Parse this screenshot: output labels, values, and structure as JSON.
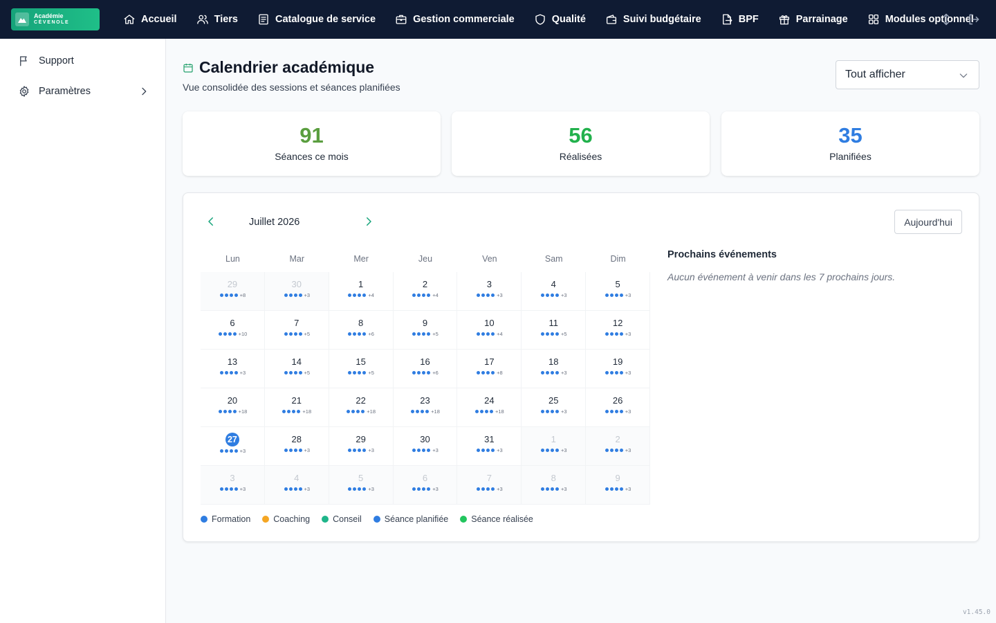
{
  "brand": {
    "line1": "Académie",
    "line2": "CÉVENOLE"
  },
  "nav": [
    {
      "label": "Accueil",
      "icon": "home-icon"
    },
    {
      "label": "Tiers",
      "icon": "users-icon"
    },
    {
      "label": "Catalogue de service",
      "icon": "catalog-icon"
    },
    {
      "label": "Gestion commerciale",
      "icon": "briefcase-icon"
    },
    {
      "label": "Qualité",
      "icon": "shield-icon"
    },
    {
      "label": "Suivi budgétaire",
      "icon": "wallet-icon"
    },
    {
      "label": "BPF",
      "icon": "bpf-icon"
    },
    {
      "label": "Parrainage",
      "icon": "gift-icon"
    },
    {
      "label": "Modules optionnel",
      "icon": "grid-icon"
    }
  ],
  "sidebar": [
    {
      "label": "Support",
      "icon": "flag-icon"
    },
    {
      "label": "Paramètres",
      "icon": "gear-icon"
    }
  ],
  "header": {
    "title": "Calendrier académique",
    "subtitle": "Vue consolidée des sessions et séances planifiées",
    "filter": "Tout afficher"
  },
  "stats": [
    {
      "value": "91",
      "label": "Séances ce mois",
      "color": "#5a9e3f"
    },
    {
      "value": "56",
      "label": "Réalisées",
      "color": "#22b14c"
    },
    {
      "value": "35",
      "label": "Planifiées",
      "color": "#2f7de1"
    }
  ],
  "calendar": {
    "month": "Juillet 2026",
    "today_button": "Aujourd'hui",
    "weekdays": [
      "Lun",
      "Mar",
      "Mer",
      "Jeu",
      "Ven",
      "Sam",
      "Dim"
    ],
    "weeks": [
      [
        {
          "d": "29",
          "m": "+8",
          "o": true
        },
        {
          "d": "30",
          "m": "+3",
          "o": true
        },
        {
          "d": "1",
          "m": "+4"
        },
        {
          "d": "2",
          "m": "+4"
        },
        {
          "d": "3",
          "m": "+3"
        },
        {
          "d": "4",
          "m": "+3"
        },
        {
          "d": "5",
          "m": "+3"
        }
      ],
      [
        {
          "d": "6",
          "m": "+10"
        },
        {
          "d": "7",
          "m": "+5"
        },
        {
          "d": "8",
          "m": "+6"
        },
        {
          "d": "9",
          "m": "+5"
        },
        {
          "d": "10",
          "m": "+4"
        },
        {
          "d": "11",
          "m": "+5"
        },
        {
          "d": "12",
          "m": "+3"
        }
      ],
      [
        {
          "d": "13",
          "m": "+3"
        },
        {
          "d": "14",
          "m": "+5"
        },
        {
          "d": "15",
          "m": "+5"
        },
        {
          "d": "16",
          "m": "+6"
        },
        {
          "d": "17",
          "m": "+8"
        },
        {
          "d": "18",
          "m": "+3"
        },
        {
          "d": "19",
          "m": "+3"
        }
      ],
      [
        {
          "d": "20",
          "m": "+18"
        },
        {
          "d": "21",
          "m": "+18"
        },
        {
          "d": "22",
          "m": "+18"
        },
        {
          "d": "23",
          "m": "+18"
        },
        {
          "d": "24",
          "m": "+18"
        },
        {
          "d": "25",
          "m": "+3"
        },
        {
          "d": "26",
          "m": "+3"
        }
      ],
      [
        {
          "d": "27",
          "m": "+3",
          "t": true
        },
        {
          "d": "28",
          "m": "+3"
        },
        {
          "d": "29",
          "m": "+3"
        },
        {
          "d": "30",
          "m": "+3"
        },
        {
          "d": "31",
          "m": "+3"
        },
        {
          "d": "1",
          "m": "+3",
          "o": true
        },
        {
          "d": "2",
          "m": "+3",
          "o": true
        }
      ],
      [
        {
          "d": "3",
          "m": "+3",
          "o": true
        },
        {
          "d": "4",
          "m": "+3",
          "o": true
        },
        {
          "d": "5",
          "m": "+3",
          "o": true
        },
        {
          "d": "6",
          "m": "+3",
          "o": true
        },
        {
          "d": "7",
          "m": "+3",
          "o": true
        },
        {
          "d": "8",
          "m": "+3",
          "o": true
        },
        {
          "d": "9",
          "m": "+3",
          "o": true
        }
      ]
    ],
    "legend": [
      {
        "label": "Formation",
        "color": "#2f7de1"
      },
      {
        "label": "Coaching",
        "color": "#f5a623"
      },
      {
        "label": "Conseil",
        "color": "#1fb58a"
      },
      {
        "label": "Séance planifiée",
        "color": "#2f7de1"
      },
      {
        "label": "Séance réalisée",
        "color": "#22c55e"
      }
    ]
  },
  "upcoming": {
    "title": "Prochains événements",
    "empty": "Aucun événement à venir dans les 7 prochains jours."
  },
  "version": "v1.45.0"
}
